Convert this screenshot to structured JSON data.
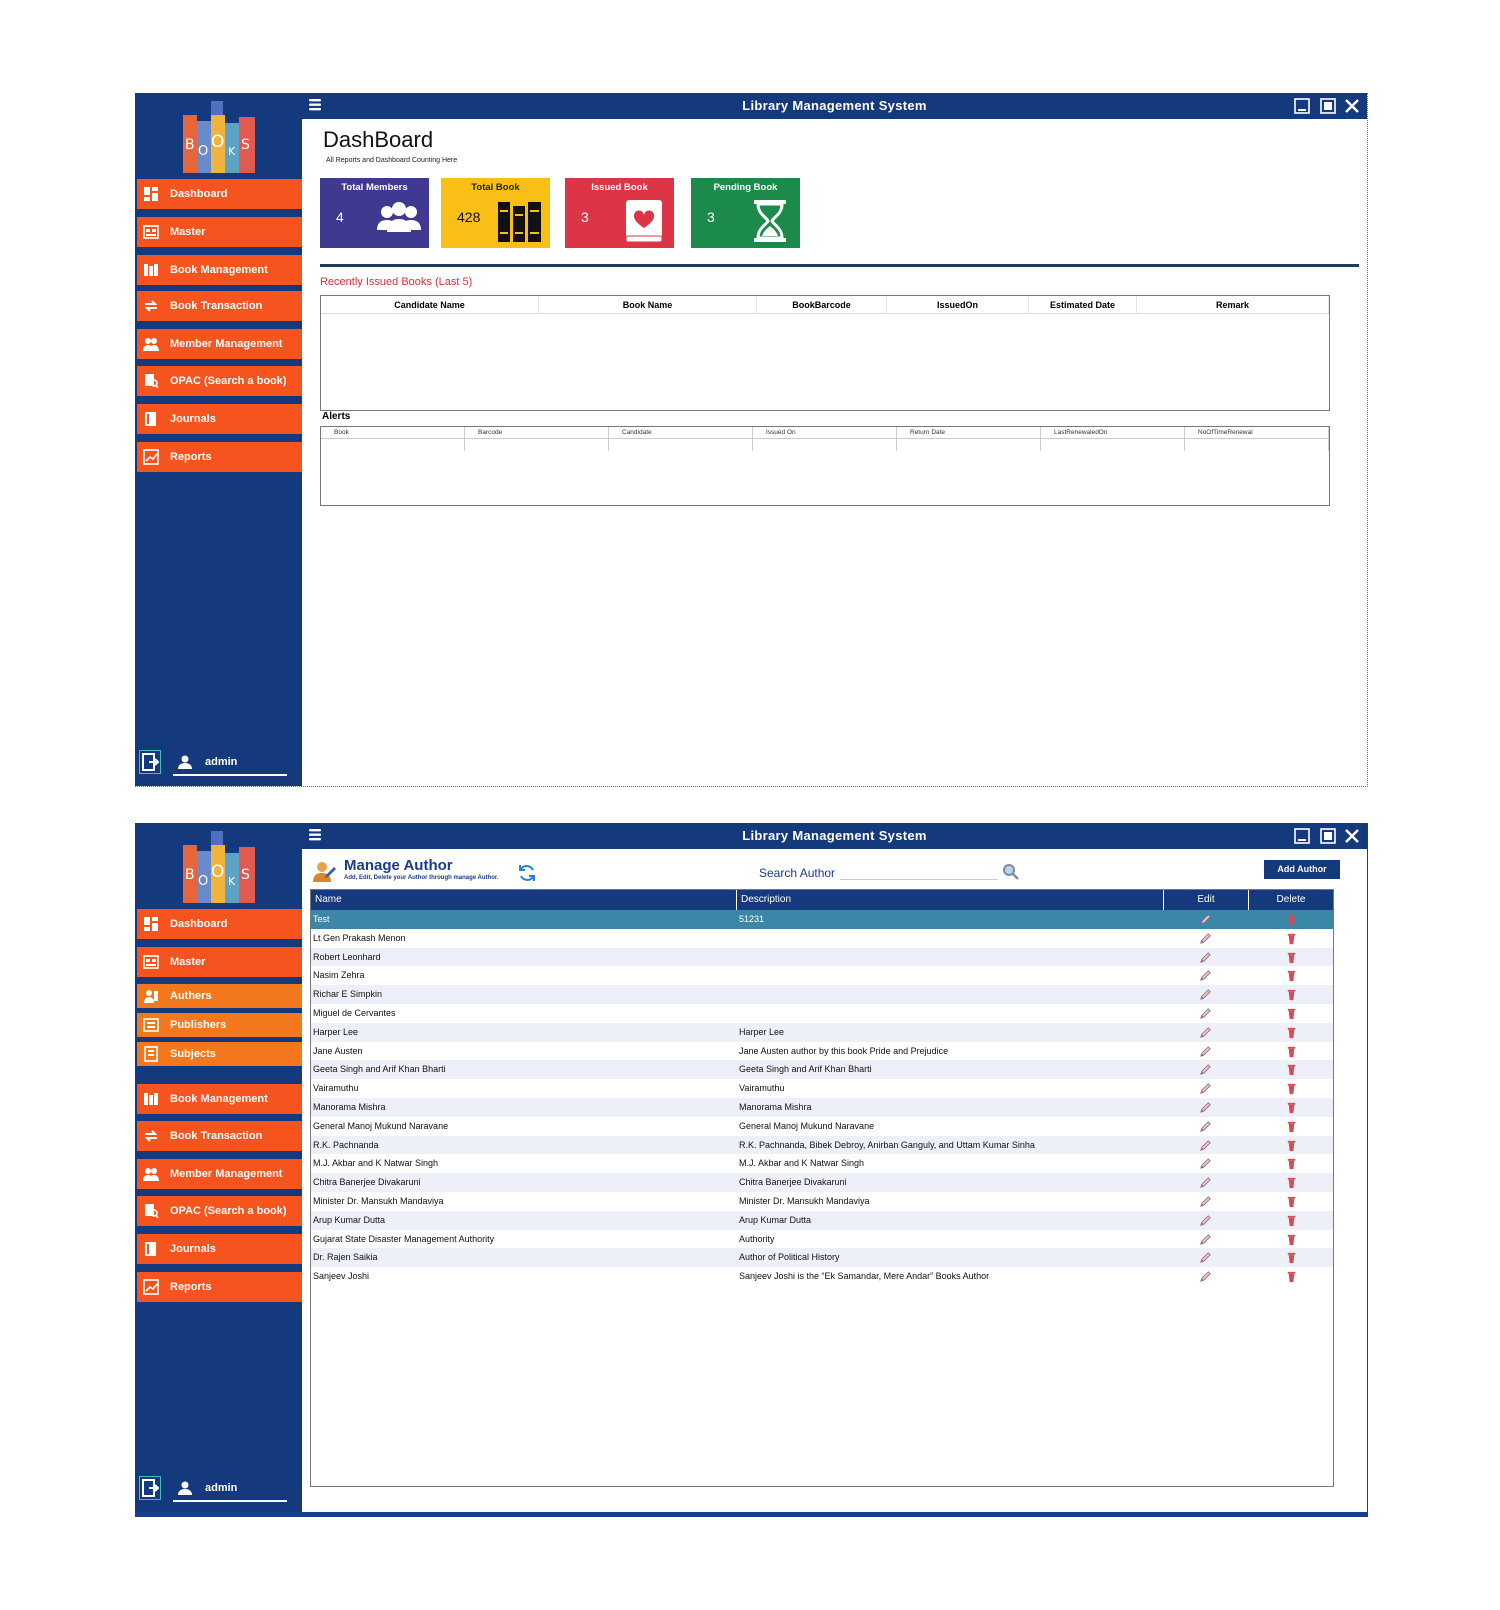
{
  "app_title": "Library Management System",
  "logo": {
    "letters": [
      "B",
      "O",
      "O",
      "K",
      "S"
    ]
  },
  "user": {
    "name": "admin"
  },
  "window1": {
    "nav": [
      {
        "label": "Dashboard",
        "icon": "dashboard-icon"
      },
      {
        "label": "Master",
        "icon": "master-icon"
      },
      {
        "label": "Book Management",
        "icon": "book-management-icon"
      },
      {
        "label": "Book Transaction",
        "icon": "book-transaction-icon"
      },
      {
        "label": "Member Management",
        "icon": "member-management-icon"
      },
      {
        "label": "OPAC (Search a book)",
        "icon": "opac-icon"
      },
      {
        "label": "Journals",
        "icon": "journals-icon"
      },
      {
        "label": "Reports",
        "icon": "reports-icon"
      }
    ],
    "dashboard": {
      "title": "DashBoard",
      "subtitle": "All Reports and Dashboard Counting Here",
      "cards": [
        {
          "title": "Total Members",
          "value": "4",
          "color": "#3f3a8f",
          "icon": "members-icon"
        },
        {
          "title": "Total Book",
          "value": "428",
          "color": "#f9bf17",
          "icon": "books-icon"
        },
        {
          "title": "Issued Book",
          "value": "3",
          "color": "#dc3545",
          "icon": "issued-book-icon"
        },
        {
          "title": "Pending Book",
          "value": "3",
          "color": "#1c8a4a",
          "icon": "hourglass-icon"
        }
      ],
      "recent_title": "Recently Issued Books (Last 5)",
      "recent_columns": [
        "Candidate Name",
        "Book Name",
        "BookBarcode",
        "IssuedOn",
        "Estimated Date",
        "Remark"
      ],
      "alerts_title": "Alerts",
      "alert_columns": [
        "Book",
        "Barcode",
        "Candidate",
        "Issued On",
        "Return Date",
        "LastRenewaledOn",
        "NoOfTimeRenewal"
      ]
    }
  },
  "window2": {
    "nav": [
      {
        "label": "Dashboard",
        "icon": "dashboard-icon",
        "sub": false
      },
      {
        "label": "Master",
        "icon": "master-icon",
        "sub": false
      },
      {
        "label": "Authers",
        "icon": "authors-icon",
        "sub": true
      },
      {
        "label": "Publishers",
        "icon": "publishers-icon",
        "sub": true
      },
      {
        "label": "Subjects",
        "icon": "subjects-icon",
        "sub": true
      },
      {
        "label": "Book Management",
        "icon": "book-management-icon",
        "sub": false
      },
      {
        "label": "Book Transaction",
        "icon": "book-transaction-icon",
        "sub": false
      },
      {
        "label": "Member Management",
        "icon": "member-management-icon",
        "sub": false
      },
      {
        "label": "OPAC (Search a book)",
        "icon": "opac-icon",
        "sub": false
      },
      {
        "label": "Journals",
        "icon": "journals-icon",
        "sub": false
      },
      {
        "label": "Reports",
        "icon": "reports-icon",
        "sub": false
      }
    ],
    "manage_author": {
      "title": "Manage Author",
      "subtitle": "Add, Edit, Delete your Author through manage Author.",
      "search_label": "Search Author",
      "search_value": "",
      "add_button": "Add Author",
      "columns": [
        "Name",
        "Description",
        "Edit",
        "Delete"
      ],
      "rows": [
        {
          "name": "Test",
          "description": "51231",
          "selected": true
        },
        {
          "name": "Lt Gen Prakash Menon",
          "description": ""
        },
        {
          "name": "Robert Leonhard",
          "description": ""
        },
        {
          "name": "Nasim Zehra",
          "description": ""
        },
        {
          "name": "Richar E Simpkin",
          "description": ""
        },
        {
          "name": "Miguel de Cervantes",
          "description": ""
        },
        {
          "name": " Harper Lee",
          "description": " Harper Lee"
        },
        {
          "name": "Jane Austen",
          "description": "Jane Austen author by this book Pride and Prejudice"
        },
        {
          "name": "Geeta Singh and Arif Khan Bharti",
          "description": "Geeta Singh and Arif Khan Bharti"
        },
        {
          "name": "Vairamuthu",
          "description": "Vairamuthu"
        },
        {
          "name": "Manorama Mishra",
          "description": "Manorama Mishra"
        },
        {
          "name": "General Manoj Mukund Naravane",
          "description": "General Manoj Mukund Naravane"
        },
        {
          "name": "R.K. Pachnanda",
          "description": "R.K. Pachnanda, Bibek Debroy, Anirban Ganguly, and Uttam Kumar Sinha"
        },
        {
          "name": "M.J. Akbar and K Natwar Singh",
          "description": "M.J. Akbar and K Natwar Singh"
        },
        {
          "name": "Chitra Banerjee Divakaruni",
          "description": "Chitra Banerjee Divakaruni"
        },
        {
          "name": "Minister Dr. Mansukh Mandaviya",
          "description": "Minister Dr. Mansukh Mandaviya"
        },
        {
          "name": "Arup Kumar Dutta",
          "description": "Arup Kumar Dutta"
        },
        {
          "name": "Gujarat State Disaster Management Authority",
          "description": "Authority"
        },
        {
          "name": "Dr. Rajen Saikia",
          "description": "Author of Political History"
        },
        {
          "name": "Sanjeev Joshi",
          "description": "Sanjeev Joshi is the  “Ek Samandar, Mere Andar”  Books Author"
        }
      ]
    }
  }
}
